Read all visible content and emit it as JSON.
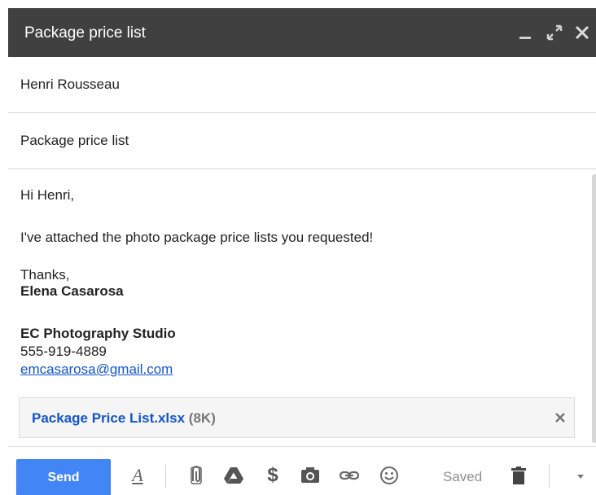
{
  "window": {
    "title": "Package price list"
  },
  "to": {
    "value": "Henri Rousseau"
  },
  "subject": {
    "value": "Package price list"
  },
  "body": {
    "greeting": "Hi Henri,",
    "message": "I've attached the photo package price lists you requested!",
    "signoff": "Thanks,",
    "sender_name": "Elena Casarosa",
    "studio": "EC Photography Studio",
    "phone": "555-919-4889",
    "email": "emcasarosa@gmail.com"
  },
  "attachment": {
    "filename": "Package Price List.xlsx",
    "size": "(8K)"
  },
  "toolbar": {
    "send_label": "Send",
    "saved_label": "Saved",
    "icons": [
      "formatting-icon",
      "paperclip-icon",
      "drive-icon",
      "dollar-icon",
      "camera-icon",
      "link-icon",
      "emoji-icon",
      "trash-icon",
      "chevron-down-icon"
    ]
  },
  "colors": {
    "titlebar": "#404040",
    "send_button": "#4285f4",
    "link": "#1155cc"
  }
}
